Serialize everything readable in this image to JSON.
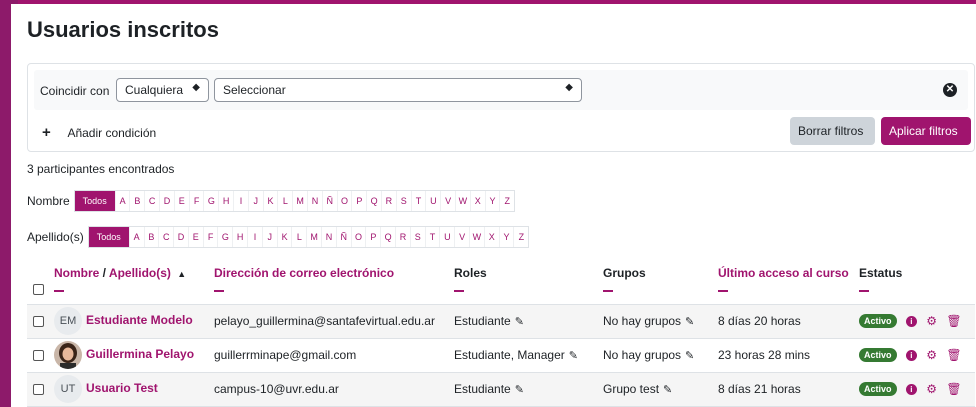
{
  "page_title": "Usuarios inscritos",
  "filter": {
    "match_label": "Coincidir con",
    "match_value": "Cualquiera",
    "select_value": "Seleccionar",
    "add_condition": "Añadir condición",
    "clear_label": "Borrar filtros",
    "apply_label": "Aplicar filtros"
  },
  "participants_count": "3 participantes encontrados",
  "first_name_filter": {
    "label": "Nombre",
    "all": "Todos",
    "letters": [
      "A",
      "B",
      "C",
      "D",
      "E",
      "F",
      "G",
      "H",
      "I",
      "J",
      "K",
      "L",
      "M",
      "N",
      "Ñ",
      "O",
      "P",
      "Q",
      "R",
      "S",
      "T",
      "U",
      "V",
      "W",
      "X",
      "Y",
      "Z"
    ]
  },
  "last_name_filter": {
    "label": "Apellido(s)",
    "all": "Todos",
    "letters": [
      "A",
      "B",
      "C",
      "D",
      "E",
      "F",
      "G",
      "H",
      "I",
      "J",
      "K",
      "L",
      "M",
      "N",
      "Ñ",
      "O",
      "P",
      "Q",
      "R",
      "S",
      "T",
      "U",
      "V",
      "W",
      "X",
      "Y",
      "Z"
    ]
  },
  "table": {
    "headers": {
      "name": "Nombre",
      "separator": " / ",
      "lastname": "Apellido(s)",
      "sort_arrow": "▲",
      "email": "Dirección de correo electrónico",
      "roles": "Roles",
      "groups": "Grupos",
      "last_access": "Último acceso al curso",
      "status": "Estatus"
    },
    "rows": [
      {
        "initials": "EM",
        "name": "Estudiante Modelo",
        "email": "pelayo_guillermina@santafevirtual.edu.ar",
        "roles": "Estudiante",
        "groups": "No hay grupos",
        "last_access": "8 días 20 horas",
        "status": "Activo"
      },
      {
        "initials": "",
        "name": "Guillermina Pelayo",
        "email": "guillerrminape@gmail.com",
        "roles": "Estudiante, Manager",
        "groups": "No hay grupos",
        "last_access": "23 horas 28 mins",
        "status": "Activo"
      },
      {
        "initials": "UT",
        "name": "Usuario Test",
        "email": "campus-10@uvr.edu.ar",
        "roles": "Estudiante",
        "groups": "Grupo test",
        "last_access": "8 días 21 horas",
        "status": "Activo"
      }
    ]
  },
  "colors": {
    "brand": "#a0146e",
    "active_badge": "#357a32"
  }
}
